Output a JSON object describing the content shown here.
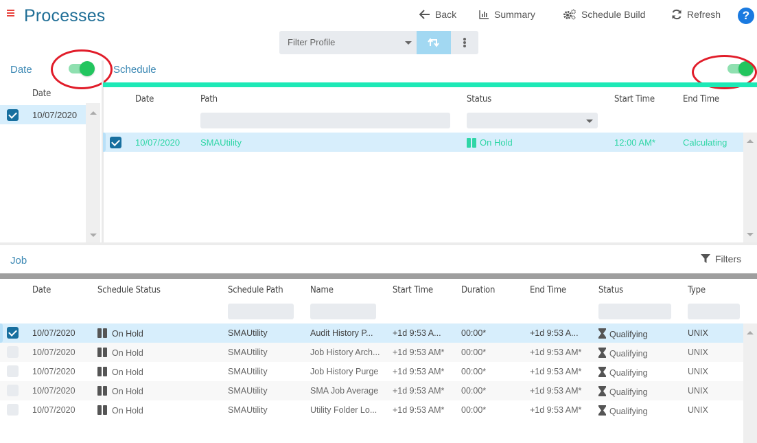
{
  "header": {
    "title": "Processes",
    "back_label": "Back",
    "summary_label": "Summary",
    "schedule_build_label": "Schedule Build",
    "refresh_label": "Refresh",
    "help_label": "?"
  },
  "filter_profile": {
    "placeholder": "Filter Profile"
  },
  "date_panel": {
    "label": "Date",
    "toggle_on": true,
    "column_header": "Date",
    "rows": [
      {
        "date": "10/07/2020",
        "checked": true
      }
    ]
  },
  "schedule": {
    "label": "Schedule",
    "toggle_on": true,
    "columns": [
      "Date",
      "Path",
      "Status",
      "Start Time",
      "End Time"
    ],
    "rows": [
      {
        "date": "10/07/2020",
        "path": "SMAUtility",
        "status": "On Hold",
        "start_time": "12:00 AM*",
        "end_time": "Calculating",
        "checked": true
      }
    ]
  },
  "job": {
    "label": "Job",
    "filters_label": "Filters",
    "columns": [
      "Date",
      "Schedule Status",
      "Schedule Path",
      "Name",
      "Start Time",
      "Duration",
      "End Time",
      "Status",
      "Type"
    ],
    "rows": [
      {
        "date": "10/07/2020",
        "schedule_status": "On Hold",
        "schedule_path": "SMAUtility",
        "name": "Audit History P...",
        "start_time": "+1d 9:53 A...",
        "duration": "00:00*",
        "end_time": "+1d 9:53 A...",
        "status": "Qualifying",
        "type": "UNIX",
        "checked": true
      },
      {
        "date": "10/07/2020",
        "schedule_status": "On Hold",
        "schedule_path": "SMAUtility",
        "name": "Job History Arch...",
        "start_time": "+1d 9:53 AM*",
        "duration": "00:00*",
        "end_time": "+1d 9:53 AM*",
        "status": "Qualifying",
        "type": "UNIX",
        "checked": false
      },
      {
        "date": "10/07/2020",
        "schedule_status": "On Hold",
        "schedule_path": "SMAUtility",
        "name": "Job History Purge",
        "start_time": "+1d 9:53 AM*",
        "duration": "00:00*",
        "end_time": "+1d 9:53 AM*",
        "status": "Qualifying",
        "type": "UNIX",
        "checked": false
      },
      {
        "date": "10/07/2020",
        "schedule_status": "On Hold",
        "schedule_path": "SMAUtility",
        "name": "SMA Job Average",
        "start_time": "+1d 9:53 AM*",
        "duration": "00:00*",
        "end_time": "+1d 9:53 AM*",
        "status": "Qualifying",
        "type": "UNIX",
        "checked": false
      },
      {
        "date": "10/07/2020",
        "schedule_status": "On Hold",
        "schedule_path": "SMAUtility",
        "name": "Utility Folder Lo...",
        "start_time": "+1d 9:53 AM*",
        "duration": "00:00*",
        "end_time": "+1d 9:53 AM*",
        "status": "Qualifying",
        "type": "UNIX",
        "checked": false
      }
    ]
  },
  "colors": {
    "title": "#1f6e96",
    "accent_teal": "#1de9b6",
    "toggle_on": "#22c55e",
    "menu_red": "#e8413c",
    "annotation_red": "#e11d2a",
    "selected_row": "#d7eefc",
    "help_blue": "#1a7ae0"
  }
}
